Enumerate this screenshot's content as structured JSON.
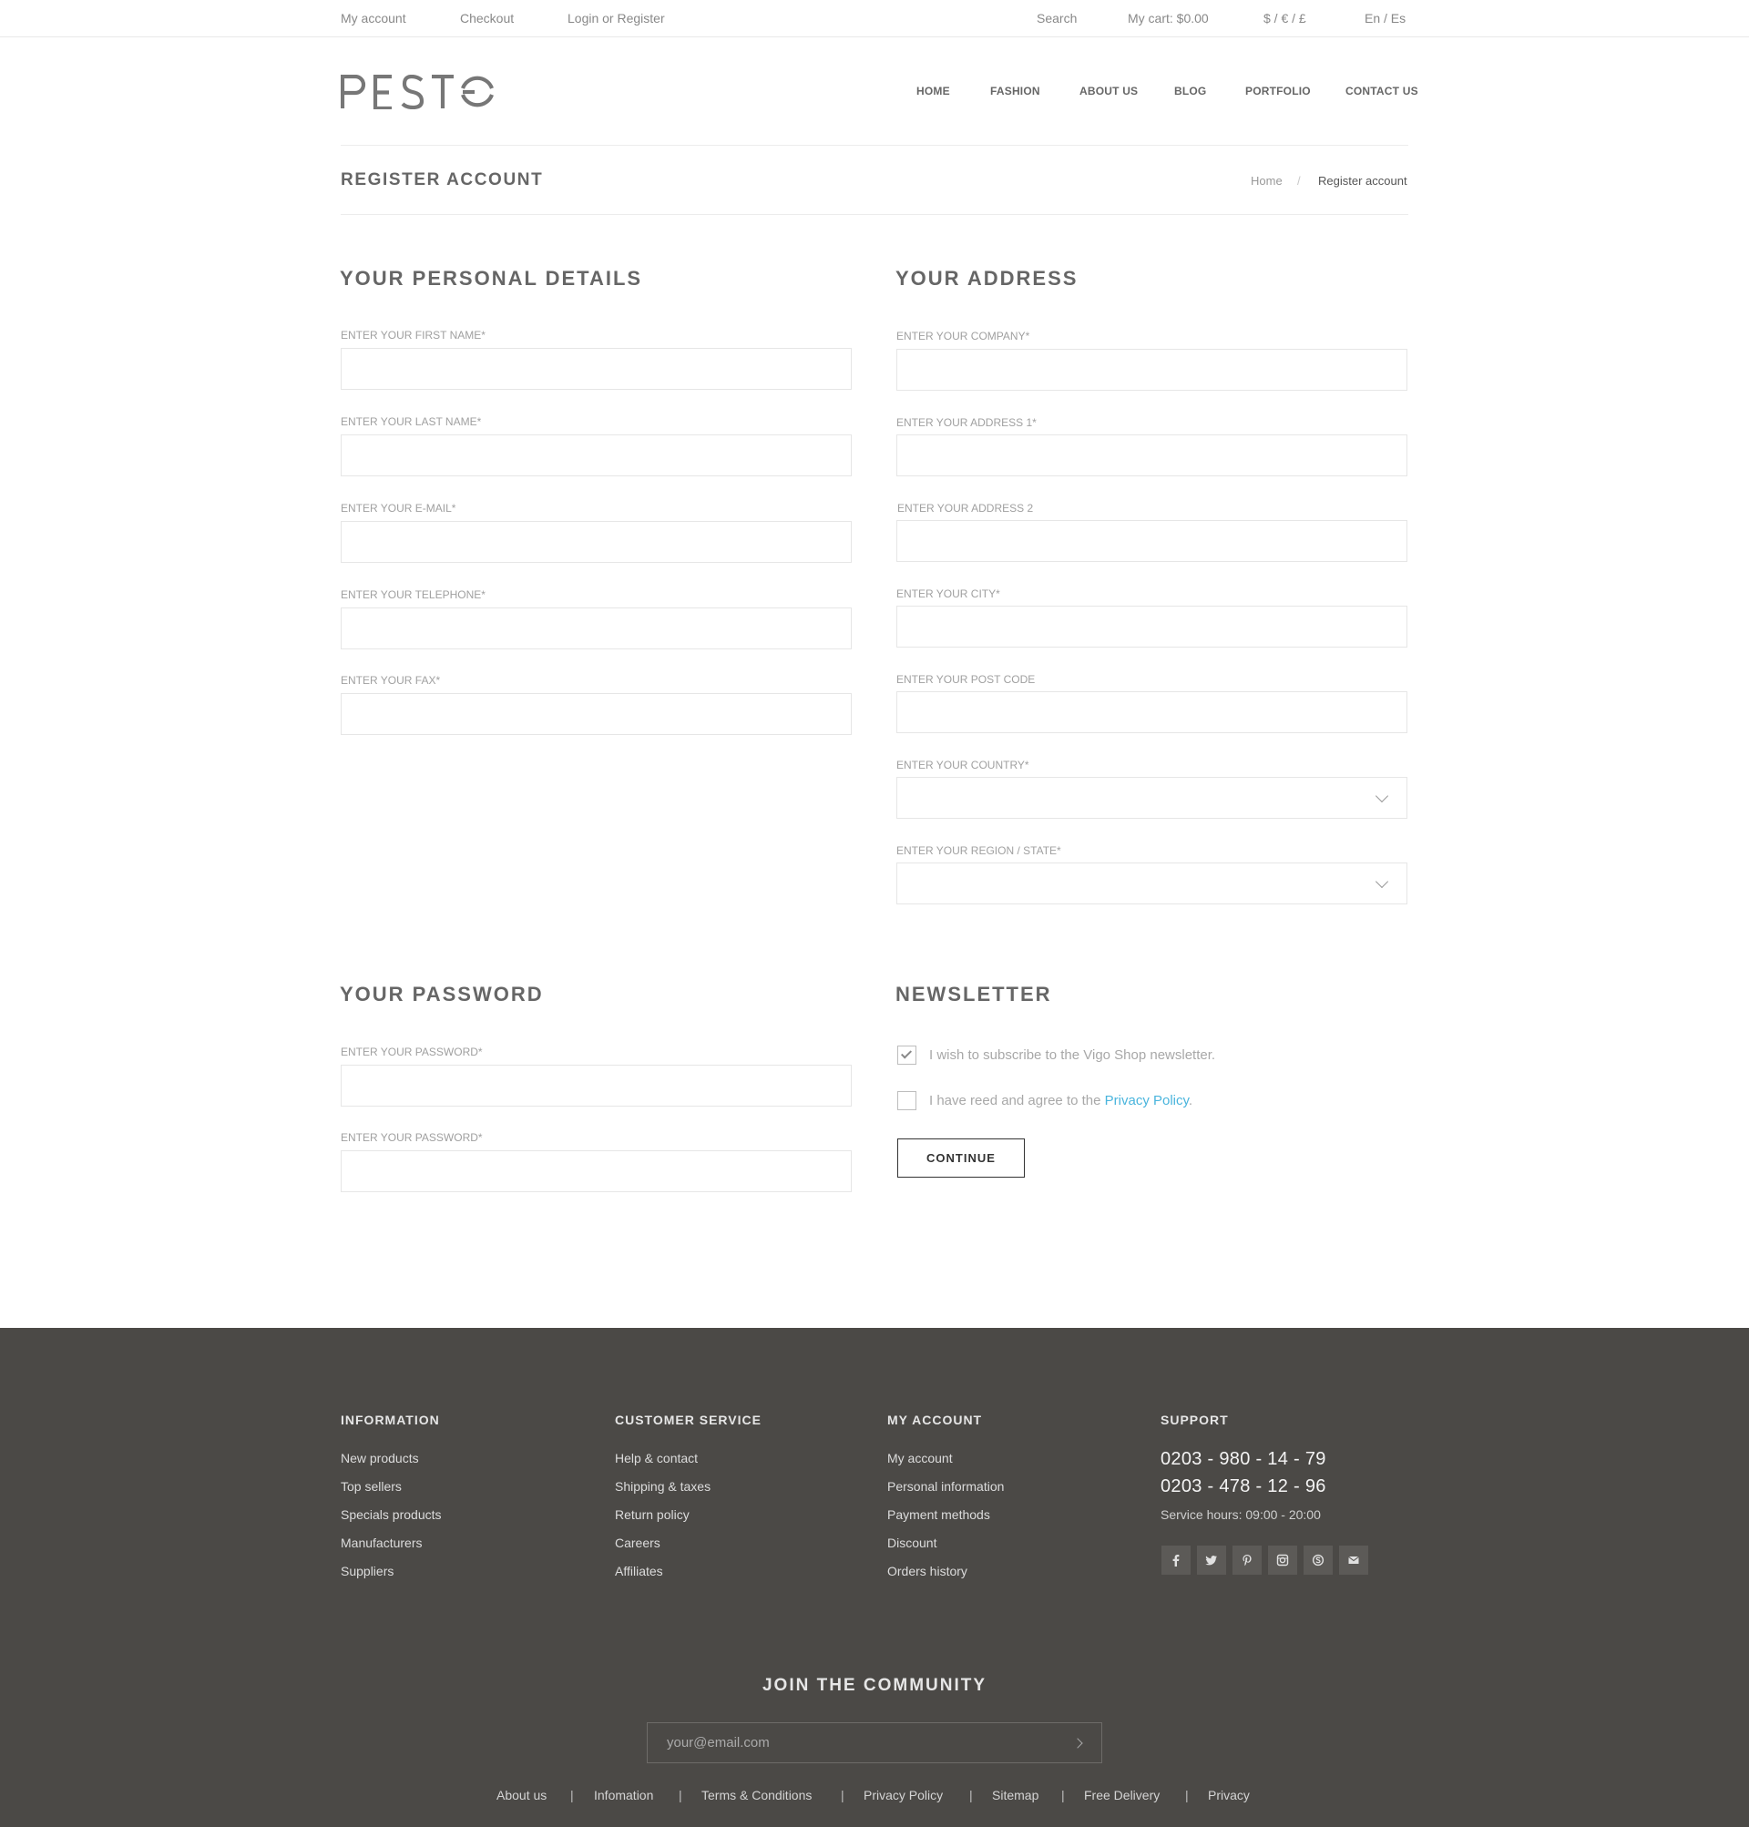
{
  "topbar": {
    "my_account": "My account",
    "checkout": "Checkout",
    "login_register": "Login or Register",
    "search": "Search",
    "cart": "My cart: $0.00",
    "currency": "$ / € / £",
    "language": "En / Es"
  },
  "logo": {
    "text": "PESTO"
  },
  "nav": {
    "home": "HOME",
    "fashion": "FASHION",
    "about": "ABOUT US",
    "blog": "BLOG",
    "portfolio": "PORTFOLIO",
    "contact": "CONTACT US"
  },
  "page": {
    "title": "REGISTER ACCOUNT"
  },
  "breadcrumb": {
    "home": "Home",
    "separator": "/",
    "current": "Register account"
  },
  "personal": {
    "title": "YOUR PERSONAL DETAILS",
    "first_name_label": "ENTER YOUR FIRST NAME*",
    "last_name_label": "ENTER YOUR LAST NAME*",
    "email_label": "ENTER YOUR E-MAIL*",
    "telephone_label": "ENTER YOUR TELEPHONE*",
    "fax_label": "ENTER YOUR FAX*"
  },
  "address": {
    "title": "YOUR ADDRESS",
    "company_label": "ENTER YOUR COMPANY*",
    "address1_label": "ENTER YOUR ADDRESS 1*",
    "address2_label": "ENTER YOUR ADDRESS 2",
    "city_label": "ENTER YOUR CITY*",
    "postcode_label": "ENTER YOUR POST CODE",
    "country_label": "ENTER YOUR COUNTRY*",
    "region_label": "ENTER YOUR REGION / STATE*"
  },
  "password": {
    "title": "YOUR PASSWORD",
    "password_label": "ENTER YOUR PASSWORD*",
    "confirm_label": "ENTER YOUR PASSWORD*"
  },
  "newsletter": {
    "title": "NEWSLETTER",
    "subscribe_text": "I wish to subscribe to the Vigo Shop newsletter.",
    "subscribe_checked": true,
    "agree_text": "I have reed and agree to the ",
    "agree_link": "Privacy Policy",
    "agree_suffix": ".",
    "agree_checked": false,
    "continue_label": "CONTINUE"
  },
  "footer": {
    "information": {
      "title": "INFORMATION",
      "links": [
        "New products",
        "Top sellers",
        "Specials products",
        "Manufacturers",
        "Suppliers"
      ]
    },
    "customer_service": {
      "title": "CUSTOMER SERVICE",
      "links": [
        "Help & contact",
        "Shipping & taxes",
        "Return policy",
        "Careers",
        "Affiliates"
      ]
    },
    "my_account": {
      "title": "MY ACCOUNT",
      "links": [
        "My account",
        "Personal information",
        "Payment methods",
        "Discount",
        "Orders history"
      ]
    },
    "support": {
      "title": "SUPPORT",
      "phone1": "0203 - 980 - 14 - 79",
      "phone2": "0203 - 478 - 12 - 96",
      "hours": "Service hours: 09:00 - 20:00",
      "social_icons": [
        "facebook-icon",
        "twitter-icon",
        "pinterest-icon",
        "instagram-icon",
        "skype-icon",
        "email-icon"
      ]
    },
    "join_title": "JOIN THE COMMUNITY",
    "email_placeholder": "your@email.com",
    "bottom_links": [
      "About us",
      "Infomation",
      "Terms & Conditions",
      "Privacy Policy",
      "Sitemap",
      "Free Delivery",
      "Privacy"
    ],
    "separator": "|"
  },
  "colors": {
    "footer_bg": "#4b4946",
    "link_accent": "#4ab5dd",
    "text": "#666666"
  }
}
